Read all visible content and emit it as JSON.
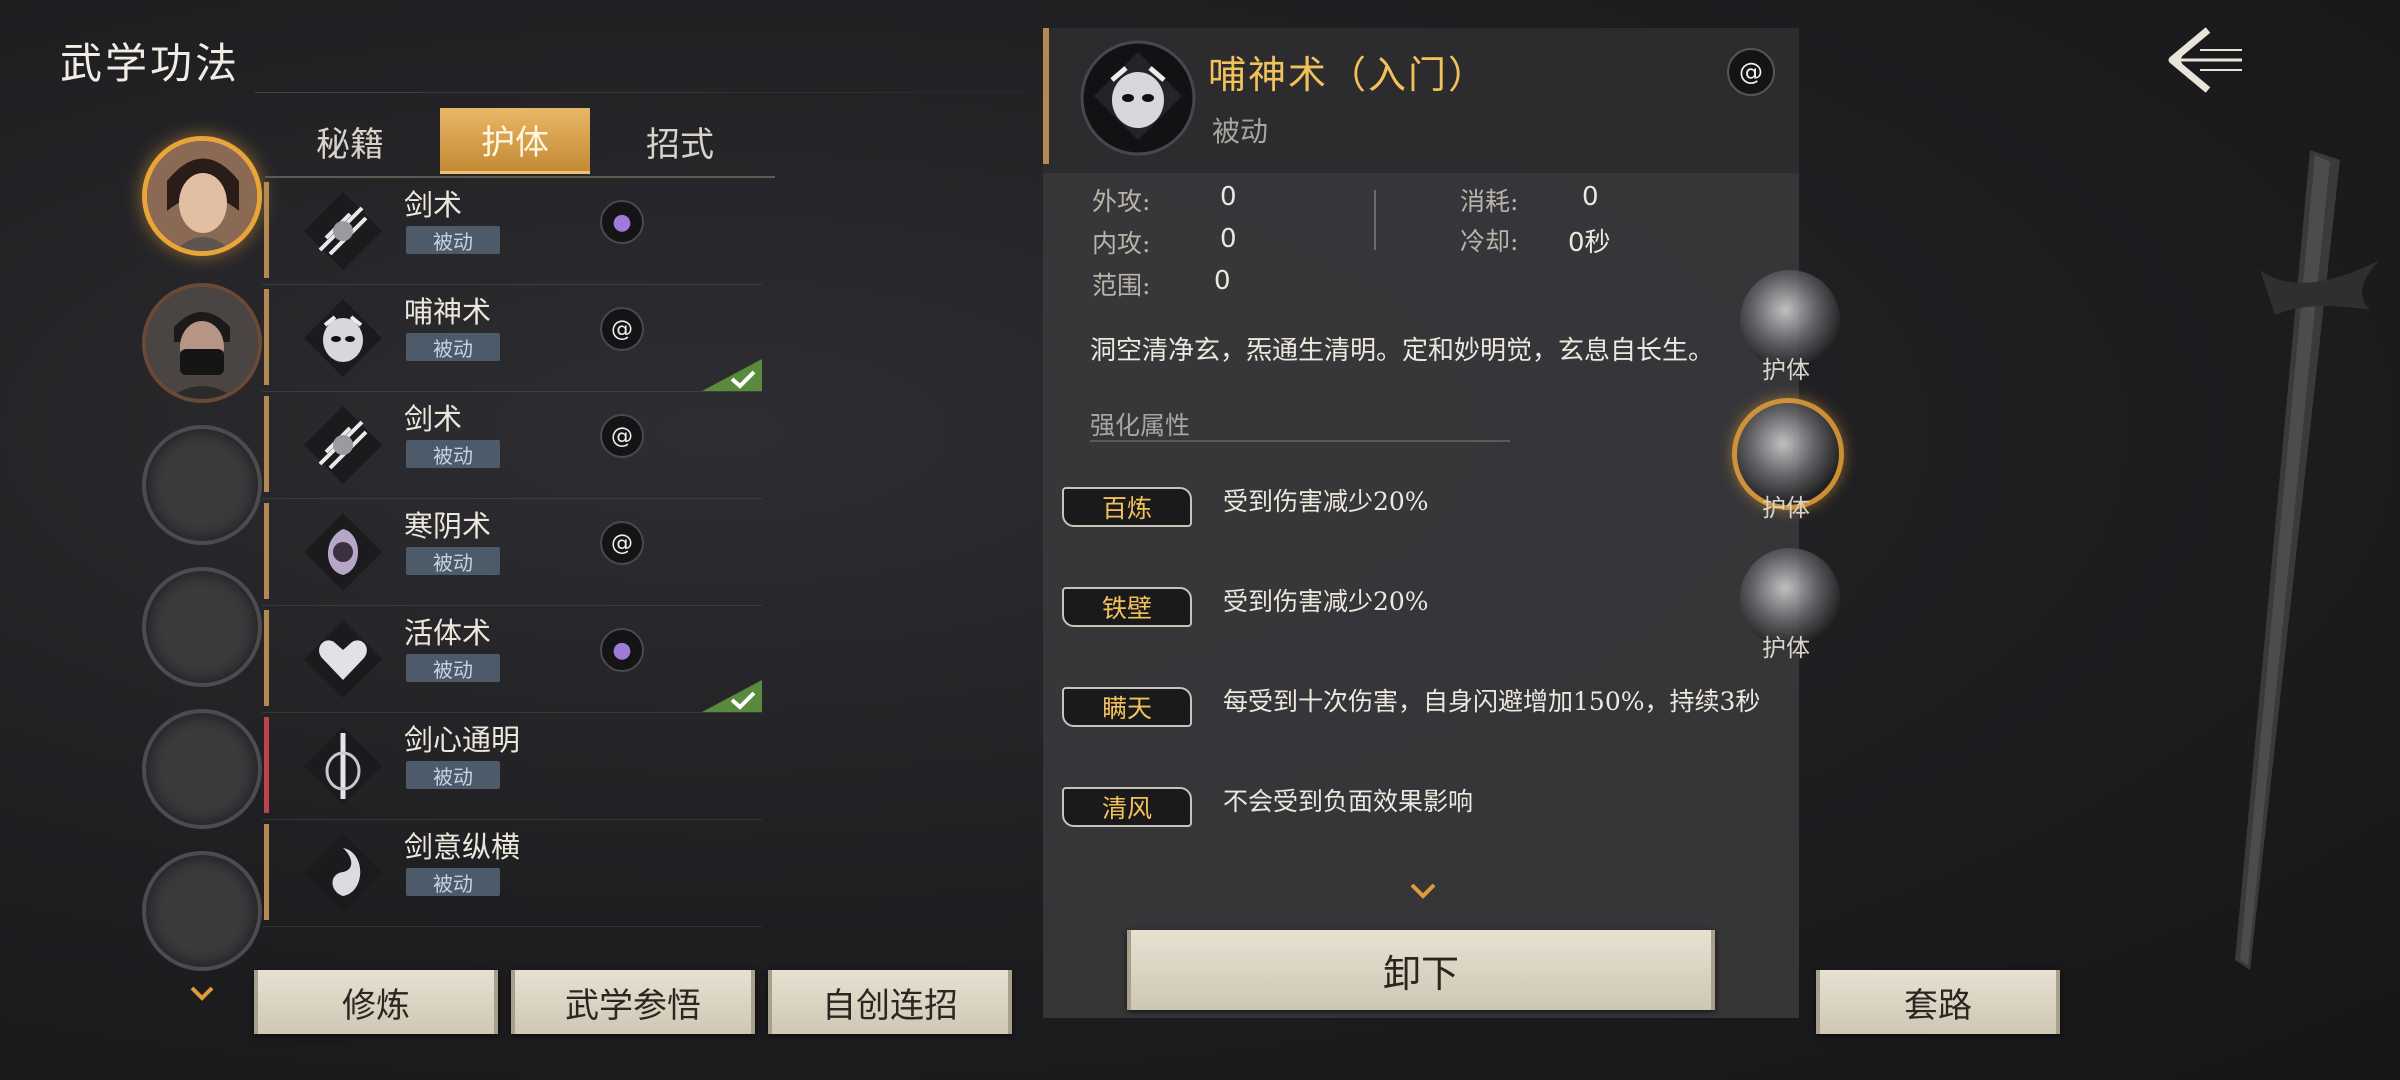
{
  "header": {
    "title": "武学功法"
  },
  "tabs": [
    {
      "label": "秘籍",
      "active": false
    },
    {
      "label": "护体",
      "active": true
    },
    {
      "label": "招式",
      "active": false
    }
  ],
  "skills": [
    {
      "name": "剑术",
      "badge": "被动",
      "element": "purple-drop-icon",
      "equipped": false
    },
    {
      "name": "哺神术",
      "badge": "被动",
      "element": "swirl-icon",
      "equipped": true
    },
    {
      "name": "剑术",
      "badge": "被动",
      "element": "swirl-icon",
      "equipped": false
    },
    {
      "name": "寒阴术",
      "badge": "被动",
      "element": "swirl-icon",
      "equipped": false
    },
    {
      "name": "活体术",
      "badge": "被动",
      "element": "purple-drop-icon",
      "equipped": true
    },
    {
      "name": "剑心通明",
      "badge": "被动",
      "element": "none",
      "equipped": false
    },
    {
      "name": "剑意纵横",
      "badge": "被动",
      "element": "none",
      "equipped": false
    }
  ],
  "bottom_buttons": {
    "train": "修炼",
    "insight": "武学参悟",
    "custom_combo": "自创连招",
    "unequip": "卸下",
    "routine": "套路"
  },
  "detail": {
    "name": "哺神术（入门）",
    "type": "被动",
    "stats": {
      "outer_attack_label": "外攻:",
      "outer_attack": "0",
      "inner_attack_label": "内攻:",
      "inner_attack": "0",
      "range_label": "范围:",
      "range": "0",
      "cost_label": "消耗:",
      "cost": "0",
      "cooldown_label": "冷却:",
      "cooldown": "0秒"
    },
    "description": "洞空清净玄，炁通生清明。定和妙明觉，玄息自长生。",
    "enhance_title": "强化属性",
    "enhancements": [
      {
        "tag": "百炼",
        "text": "受到伤害减少20%"
      },
      {
        "tag": "铁壁",
        "text": "受到伤害减少20%"
      },
      {
        "tag": "瞒天",
        "text": "每受到十次伤害，自身闪避增加150%，持续3秒"
      },
      {
        "tag": "清风",
        "text": "不会受到负面效果影响"
      }
    ]
  },
  "side_slots": [
    "护体",
    "护体",
    "护体"
  ],
  "colors": {
    "accent_gold": "#f2c25a",
    "active_tab": "#d9a24d",
    "badge_bg": "#4c5a6a",
    "check_green": "#5a8a3c"
  }
}
